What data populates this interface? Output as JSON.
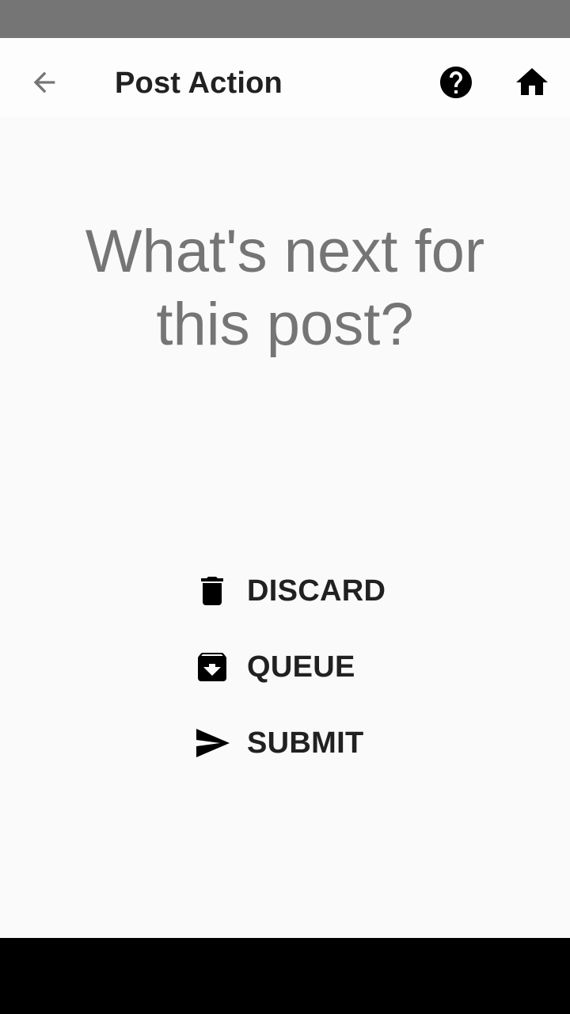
{
  "app_bar": {
    "title": "Post Action",
    "back_icon": "arrow-back-icon",
    "help_icon": "help-circle-icon",
    "home_icon": "home-icon"
  },
  "main": {
    "headline": "What's next for this post?"
  },
  "actions": [
    {
      "label": "DISCARD",
      "icon": "trash-icon"
    },
    {
      "label": "QUEUE",
      "icon": "archive-icon"
    },
    {
      "label": "SUBMIT",
      "icon": "send-icon"
    }
  ],
  "colors": {
    "status_bar": "#757575",
    "background": "#fafafa",
    "headline": "#757575",
    "text": "#212121",
    "nav_bar": "#000000"
  }
}
